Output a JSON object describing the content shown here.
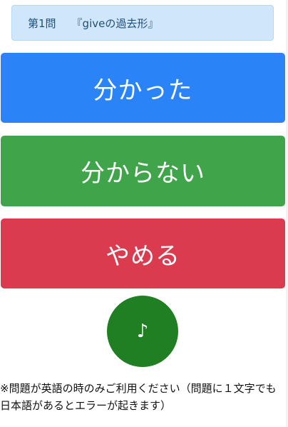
{
  "question": {
    "number": "第1問",
    "prompt": "『giveの過去形』"
  },
  "buttons": {
    "know": "分かった",
    "dont_know": "分からない",
    "quit": "やめる"
  },
  "sound": {
    "icon_symbol": "♪",
    "icon_name": "music-note-icon"
  },
  "note": "※問題が英語の時のみご利用ください（問題に１文字でも日本語があるとエラーが起きます）",
  "colors": {
    "question_bg": "#cfe6fb",
    "know": "#2b84f7",
    "dont_know": "#3fa44a",
    "quit": "#da3b4e",
    "sound": "#1f7f22"
  }
}
